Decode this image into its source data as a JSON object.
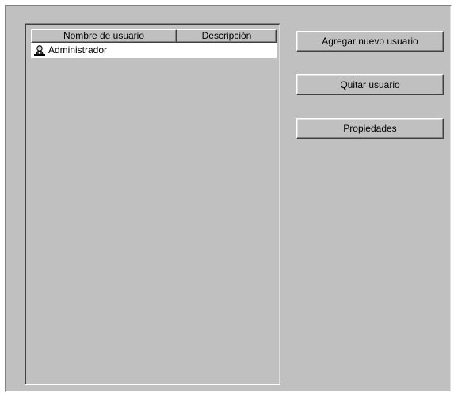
{
  "users_list": {
    "columns": {
      "name": "Nombre de usuario",
      "description": "Descripción"
    },
    "rows": [
      {
        "name": "Administrador",
        "description": "",
        "icon": "user-icon"
      }
    ]
  },
  "actions": {
    "add_user": "Agregar nuevo usuario",
    "remove_user": "Quitar usuario",
    "properties": "Propiedades"
  },
  "colors": {
    "face": "#c0c0c0",
    "list_row_bg": "#ffffff"
  }
}
